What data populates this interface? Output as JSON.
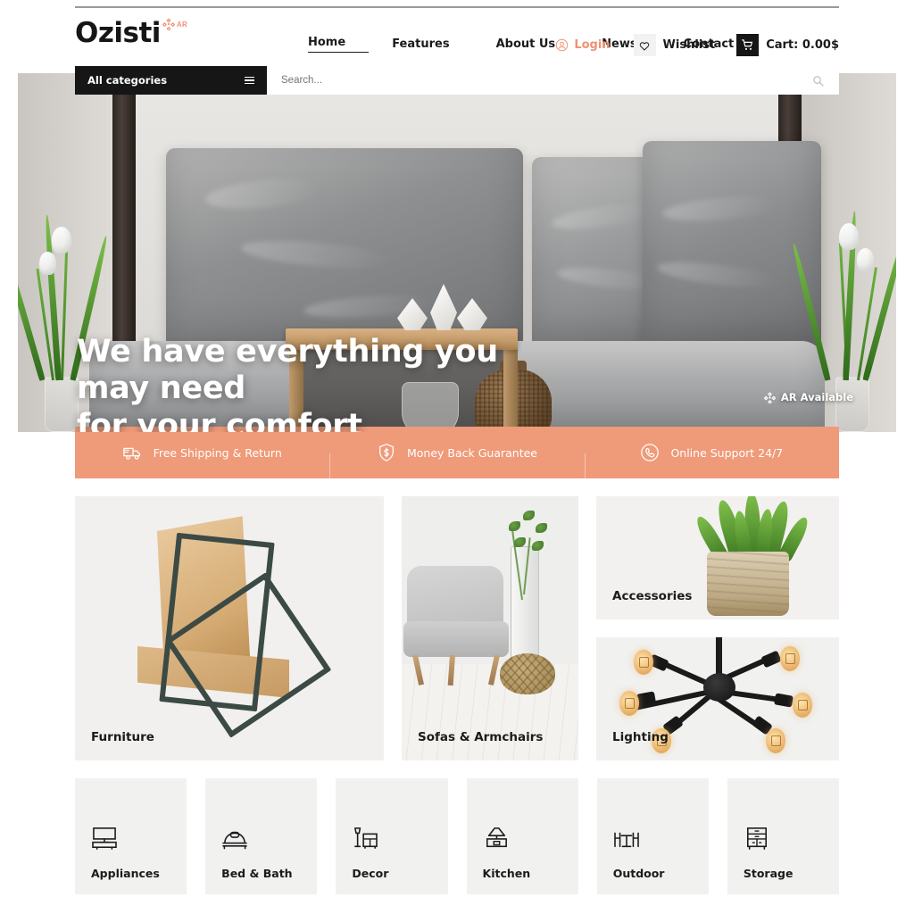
{
  "brand": {
    "name": "Ozisti",
    "ar_badge": "AR"
  },
  "nav": {
    "items": [
      {
        "label": "Home",
        "active": true
      },
      {
        "label": "Features",
        "active": false
      },
      {
        "label": "About Us",
        "active": false
      },
      {
        "label": "News",
        "active": false
      },
      {
        "label": "Contact Us",
        "active": false
      }
    ]
  },
  "header_actions": {
    "login_label": "Login",
    "wishlist_label": "Wishlist",
    "cart_label": "Cart: 0.00$"
  },
  "search": {
    "category_label": "All categories",
    "placeholder": "Search...",
    "value": ""
  },
  "hero": {
    "title_line1": "We have everything you may need",
    "title_line2": "for your comfort",
    "ar_available": "AR Available"
  },
  "features": [
    {
      "label": "Free Shipping & Return",
      "icon": "truck-icon"
    },
    {
      "label": "Money Back Guarantee",
      "icon": "shield-dollar-icon"
    },
    {
      "label": "Online Support 24/7",
      "icon": "phone-icon"
    }
  ],
  "categories": {
    "furniture": "Furniture",
    "sofas": "Sofas & Armchairs",
    "accessories": "Accessories",
    "lighting": "Lighting"
  },
  "tiles": [
    {
      "label": "Appliances",
      "icon": "tv-stand-icon"
    },
    {
      "label": "Bed & Bath",
      "icon": "bed-icon"
    },
    {
      "label": "Decor",
      "icon": "lamp-dresser-icon"
    },
    {
      "label": "Kitchen",
      "icon": "range-hood-icon"
    },
    {
      "label": "Outdoor",
      "icon": "patio-table-icon"
    },
    {
      "label": "Storage",
      "icon": "cabinet-icon"
    }
  ],
  "colors": {
    "accent": "#ef9a78",
    "dark": "#161616",
    "tile_bg": "#f1f1f0"
  }
}
